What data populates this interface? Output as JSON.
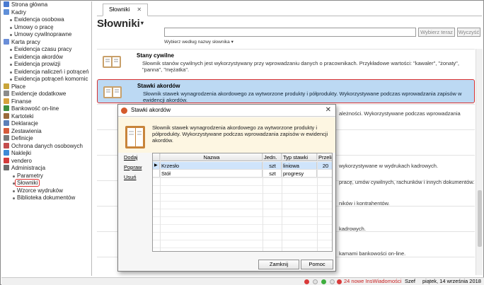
{
  "sidebar": {
    "items": [
      {
        "label": "Strona główna",
        "level": "root",
        "icon": "home-icon",
        "color": "#4a7bd0"
      },
      {
        "label": "Kadry",
        "level": "root",
        "icon": "staff-icon",
        "color": "#5f8fd8"
      },
      {
        "label": "Ewidencja osobowa",
        "level": "child"
      },
      {
        "label": "Umowy o pracę",
        "level": "child"
      },
      {
        "label": "Umowy cywilnoprawne",
        "level": "child"
      },
      {
        "label": "Karta pracy",
        "level": "root",
        "icon": "timecard-icon",
        "color": "#6a8ed8"
      },
      {
        "label": "Ewidencja czasu pracy",
        "level": "child"
      },
      {
        "label": "Ewidencja akordów",
        "level": "child"
      },
      {
        "label": "Ewidencja prowizji",
        "level": "child"
      },
      {
        "label": "Ewidencja naliczeń i potrąceń",
        "level": "child"
      },
      {
        "label": "Ewidencja potrąceń komornic",
        "level": "child"
      },
      {
        "label": "Płace",
        "level": "root",
        "icon": "payroll-icon",
        "color": "#c9a53a"
      },
      {
        "label": "Ewidencje dodatkowe",
        "level": "root",
        "icon": "extra-records-icon",
        "color": "#8b8b8b"
      },
      {
        "label": "Finanse",
        "level": "root",
        "icon": "finance-icon",
        "color": "#d7a23d"
      },
      {
        "label": "Bankowość on-line",
        "level": "root",
        "icon": "bank-icon",
        "color": "#3f8f3f"
      },
      {
        "label": "Kartoteki",
        "level": "root",
        "icon": "files-icon",
        "color": "#9a6a3a"
      },
      {
        "label": "Deklaracje",
        "level": "root",
        "icon": "declarations-icon",
        "color": "#5c7fb8"
      },
      {
        "label": "Zestawienia",
        "level": "root",
        "icon": "reports-icon",
        "color": "#d65a3a"
      },
      {
        "label": "Definicje",
        "level": "root",
        "icon": "definitions-icon",
        "color": "#7a7a7a"
      },
      {
        "label": "Ochrona danych osobowych",
        "level": "root",
        "icon": "data-protection-icon",
        "color": "#c44d4d"
      },
      {
        "label": "Naklejki",
        "level": "root",
        "icon": "labels-icon",
        "color": "#3d8ad6"
      },
      {
        "label": "vendero",
        "level": "root",
        "icon": "vendero-icon",
        "color": "#d23b3b"
      },
      {
        "label": "Administracja",
        "level": "root",
        "icon": "admin-icon",
        "color": "#6b6b6b"
      },
      {
        "label": "Parametry",
        "level": "sub"
      },
      {
        "label": "Słowniki",
        "level": "sub",
        "selected": true
      },
      {
        "label": "Wzorce wydruków",
        "level": "sub"
      },
      {
        "label": "Biblioteka dokumentów",
        "level": "sub"
      }
    ]
  },
  "tab": {
    "label": "Słowniki",
    "close": "✕"
  },
  "page": {
    "title": "Słowniki",
    "title_arrow": "▾"
  },
  "search": {
    "placeholder": "",
    "search_button": "Wybierz teraz",
    "clear_button": "Wyczyść",
    "hint": "Wybierz według nazwy słownika ▾"
  },
  "dictionaries": [
    {
      "title": "Stany cywilne",
      "desc": "Słownik stanów cywilnych jest wykorzystywany przy wprowadzaniu danych o pracownikach. Przykładowe wartości: \"kawaler\", \"żonaty\", \"panna\", \"mężatka\"."
    },
    {
      "title": "Stawki akordów",
      "desc": "Słownik stawek wynagrodzenia akordowego za wytworzone produkty i półprodukty. Wykorzystywane podczas wprowadzania zapisów w ewidencji akordów.",
      "selected": true
    }
  ],
  "partial_texts": [
    "ależności. Wykorzystywane podczas wprowadzania",
    "wykorzystywane w wydrukach kadrowych.",
    "pracę, umów cywilnych, rachunków i innych dokumentów.",
    "ników i kontrahentów.",
    "kadrowych.",
    "kamami bankowości on-line."
  ],
  "dialog": {
    "title": "Stawki akordów",
    "close": "✕",
    "description": "Słownik stawek wynagrodzenia akordowego za wytworzone produkty i półprodukty. Wykorzystywane podczas wprowadzania zapisów w ewidencji akordów.",
    "links": [
      "Dodaj",
      "Popraw",
      "Usuń"
    ],
    "columns": [
      "Nazwa",
      "Jedn.",
      "Typ stawki",
      "Przeli"
    ],
    "rows": [
      {
        "name": "Krzesło",
        "unit": "szt",
        "type": "liniowa",
        "value": "20"
      },
      {
        "name": "Stół",
        "unit": "szt",
        "type": "progresy",
        "value": ""
      }
    ],
    "close_button": "Zamknij",
    "help_button": "Pomoc"
  },
  "status": {
    "notifications": "24 nowe InsWiadomości",
    "user": "Szef",
    "date": "piątek, 14 września 2018"
  }
}
